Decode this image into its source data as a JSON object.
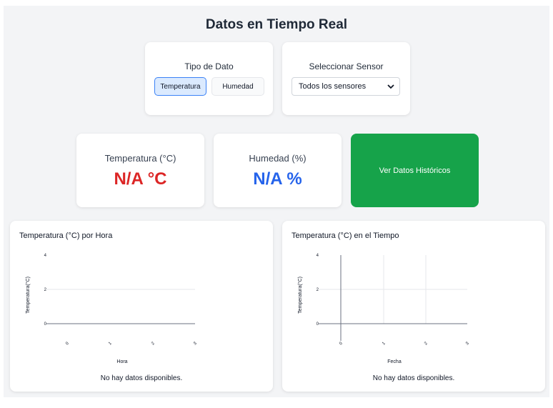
{
  "page": {
    "title": "Datos en Tiempo Real"
  },
  "data_type": {
    "label": "Tipo de Dato",
    "options": [
      "Temperatura",
      "Humedad"
    ],
    "selected": "Temperatura"
  },
  "sensor": {
    "label": "Seleccionar Sensor",
    "selected": "Todos los sensores"
  },
  "stats": {
    "temperature": {
      "label": "Temperatura (°C)",
      "value": "N/A °C",
      "color": "#dc2626"
    },
    "humidity": {
      "label": "Humedad (%)",
      "value": "N/A %",
      "color": "#2563eb"
    }
  },
  "history_button": {
    "label": "Ver Datos Históricos",
    "color": "#16a34a"
  },
  "charts": [
    {
      "title": "Temperatura (°C) por Hora",
      "empty_message": "No hay datos disponibles.",
      "chart_data": {
        "type": "line",
        "ylabel": "Temperatura(°C)",
        "xlabel": "Hora",
        "yticks": [
          "0",
          "2",
          "4"
        ],
        "xticks": [
          "0",
          "1",
          "2",
          "3"
        ],
        "ylim": [
          0,
          4
        ],
        "series": []
      }
    },
    {
      "title": "Temperatura (°C) en el Tiempo",
      "empty_message": "No hay datos disponibles.",
      "chart_data": {
        "type": "line",
        "ylabel": "Temperatura(°C)",
        "xlabel": "Fecha",
        "yticks": [
          "0",
          "2",
          "4"
        ],
        "xticks": [
          "0",
          "1",
          "2",
          "3"
        ],
        "ylim": [
          0,
          4
        ],
        "series": []
      }
    }
  ]
}
